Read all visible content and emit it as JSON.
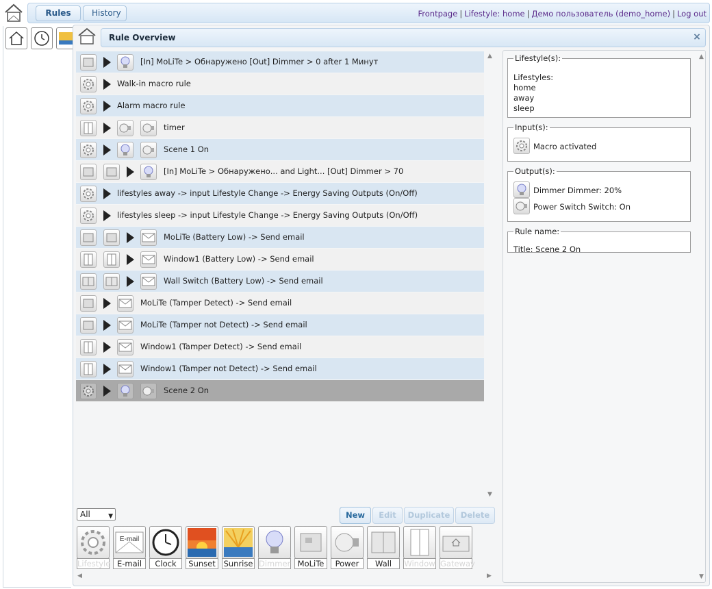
{
  "nav": {
    "rules_label": "Rules",
    "history_label": "History",
    "links": [
      "Frontpage",
      "Lifestyle: home",
      "Демо пользователь (demo_home)",
      "Log out"
    ]
  },
  "dialog": {
    "title": "Rule Overview",
    "close_label": "×"
  },
  "rules": [
    {
      "text": "[In] MoLiTe > Обнаружено [Out] Dimmer > 0 after 1 Минут"
    },
    {
      "text": "Walk-in macro rule"
    },
    {
      "text": "Alarm macro rule"
    },
    {
      "text": "timer"
    },
    {
      "text": "Scene 1 On"
    },
    {
      "text": "[In] MoLiTe > Обнаружено... and Light... [Out] Dimmer > 70"
    },
    {
      "text": "lifestyles away -> input Lifestyle Change -> Energy Saving Outputs (On/Off)"
    },
    {
      "text": "lifestyles sleep -> input Lifestyle Change -> Energy Saving Outputs (On/Off)"
    },
    {
      "text": "MoLiTe (Battery Low) -> Send email"
    },
    {
      "text": "Window1 (Battery Low) -> Send email"
    },
    {
      "text": "Wall Switch (Battery Low) -> Send email"
    },
    {
      "text": "MoLiTe (Tamper Detect) -> Send email"
    },
    {
      "text": "MoLiTe (Tamper not Detect) -> Send email"
    },
    {
      "text": "Window1 (Tamper Detect) -> Send email"
    },
    {
      "text": "Window1 (Tamper not Detect) -> Send email"
    },
    {
      "text": "Scene 2 On"
    }
  ],
  "details": {
    "lifestyles_legend": "Lifestyle(s):",
    "lifestyles_lines": [
      "Lifestyles:",
      "home",
      "away",
      "sleep"
    ],
    "inputs_legend": "Input(s):",
    "input_line": "Macro activated",
    "outputs_legend": "Output(s):",
    "output_lines": [
      "Dimmer Dimmer: 20%",
      "Power Switch Switch: On"
    ],
    "rulename_legend": "Rule name:",
    "rulename_line": "Title: Scene 2 On"
  },
  "filter": {
    "value": "All"
  },
  "actions": {
    "new": "New",
    "edit": "Edit",
    "duplicate": "Duplicate",
    "delete": "Delete"
  },
  "palette": [
    "Lifestyle",
    "E-mail",
    "Clock",
    "Sunset",
    "Sunrise",
    "Dimmer",
    "MoLiTe",
    "Power",
    "Wall",
    "Window",
    "Gateway"
  ],
  "palette_email_text": "E-mail",
  "colors": {
    "accent": "#2a6a9e",
    "selected_row": "#a9a9a9",
    "alt_row": "#d9e6f2"
  }
}
